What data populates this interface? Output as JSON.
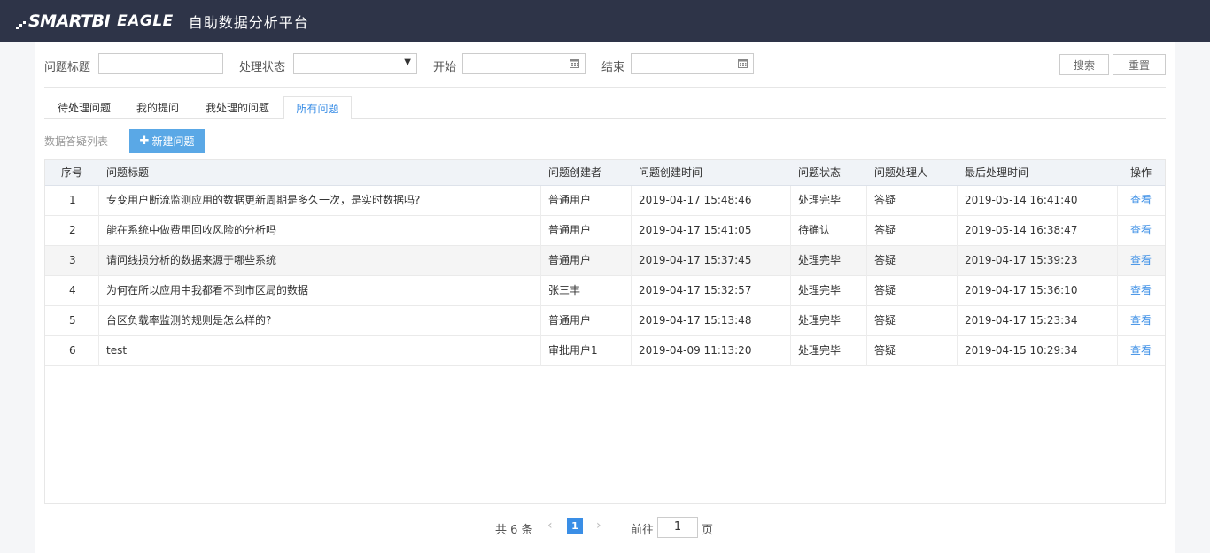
{
  "header": {
    "brand": "SMARTBI",
    "brand2": "EAGLE",
    "subtitle": "自助数据分析平台"
  },
  "filter": {
    "title_label": "问题标题",
    "title_value": "",
    "status_label": "处理状态",
    "status_value": "",
    "start_label": "开始",
    "start_value": "",
    "end_label": "结束",
    "end_value": "",
    "search_label": "搜索",
    "reset_label": "重置"
  },
  "tabs": [
    {
      "label": "待处理问题",
      "active": false
    },
    {
      "label": "我的提问",
      "active": false
    },
    {
      "label": "我处理的问题",
      "active": false
    },
    {
      "label": "所有问题",
      "active": true
    }
  ],
  "list": {
    "title": "数据答疑列表",
    "new_label": "新建问题"
  },
  "table": {
    "columns": [
      "序号",
      "问题标题",
      "问题创建者",
      "问题创建时间",
      "问题状态",
      "问题处理人",
      "最后处理时间",
      "操作"
    ],
    "rows": [
      {
        "no": "1",
        "title": "专变用户断流监测应用的数据更新周期是多久一次，是实时数据吗?",
        "creator": "普通用户",
        "created": "2019-04-17 15:48:46",
        "status": "处理完毕",
        "handler": "答疑",
        "last": "2019-05-14 16:41:40",
        "action": "查看"
      },
      {
        "no": "2",
        "title": "能在系统中做费用回收风险的分析吗",
        "creator": "普通用户",
        "created": "2019-04-17 15:41:05",
        "status": "待确认",
        "handler": "答疑",
        "last": "2019-05-14 16:38:47",
        "action": "查看"
      },
      {
        "no": "3",
        "title": "请问线损分析的数据来源于哪些系统",
        "creator": "普通用户",
        "created": "2019-04-17 15:37:45",
        "status": "处理完毕",
        "handler": "答疑",
        "last": "2019-04-17 15:39:23",
        "action": "查看"
      },
      {
        "no": "4",
        "title": "为何在所以应用中我都看不到市区局的数据",
        "creator": "张三丰",
        "created": "2019-04-17 15:32:57",
        "status": "处理完毕",
        "handler": "答疑",
        "last": "2019-04-17 15:36:10",
        "action": "查看"
      },
      {
        "no": "5",
        "title": "台区负载率监测的规则是怎么样的?",
        "creator": "普通用户",
        "created": "2019-04-17 15:13:48",
        "status": "处理完毕",
        "handler": "答疑",
        "last": "2019-04-17 15:23:34",
        "action": "查看"
      },
      {
        "no": "6",
        "title": "test",
        "creator": "审批用户1",
        "created": "2019-04-09 11:13:20",
        "status": "处理完毕",
        "handler": "答疑",
        "last": "2019-04-15 10:29:34",
        "action": "查看"
      }
    ]
  },
  "pager": {
    "total": "共 6 条",
    "current": "1",
    "goto_label": "前往",
    "goto_value": "1",
    "page_suffix": "页"
  },
  "colors": {
    "topbar": "#2e3448",
    "accent": "#3a8ee6",
    "new_button": "#5aa8e6"
  },
  "icons": {
    "logo": "smartbi-logo-mark",
    "new": "plus-icon",
    "select": "caret-down-icon",
    "date": "calendar-icon",
    "prev": "chevron-left-icon",
    "next": "chevron-right-icon"
  }
}
